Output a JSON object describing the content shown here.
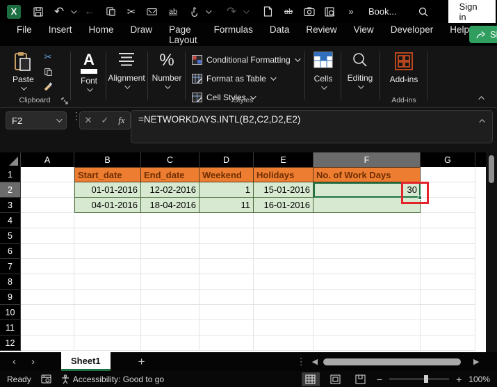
{
  "titlebar": {
    "document_title": "Book...",
    "signin_label": "Sign in",
    "glyphs": {
      "excel": "X",
      "undo": "↶",
      "redo": "↷",
      "back": "←",
      "cut": "✂",
      "replace": "ab",
      "strikethrough": "ab",
      "more": "»",
      "dots": "⋮",
      "minimize": "—",
      "maximize": "□",
      "close": "✕"
    }
  },
  "menubar": {
    "items": [
      "File",
      "Insert",
      "Home",
      "Draw",
      "Page Layout",
      "Formulas",
      "Data",
      "Review",
      "View",
      "Developer",
      "Help"
    ],
    "active_item": "Home",
    "share_label": "Share"
  },
  "ribbon": {
    "paste_label": "Paste",
    "clipboard_group_label": "Clipboard",
    "font_label": "Font",
    "font_glyph": "A",
    "alignment_label": "Alignment",
    "number_label": "Number",
    "number_glyph": "%",
    "styles_items": [
      "Conditional Formatting",
      "Format as Table",
      "Cell Styles"
    ],
    "styles_group_label": "Styles",
    "cells_label": "Cells",
    "editing_label": "Editing",
    "addins_label": "Add-ins",
    "addins_group_label": "Add-ins"
  },
  "formula_bar": {
    "name_box_value": "F2",
    "cancel_glyph": "✕",
    "enter_glyph": "✓",
    "fx_label": "fx",
    "formula": "=NETWORKDAYS.INTL(B2,C2,D2,E2)"
  },
  "sheet": {
    "columns": [
      "A",
      "B",
      "C",
      "D",
      "E",
      "F",
      "G"
    ],
    "rows": [
      "1",
      "2",
      "3",
      "4",
      "5",
      "6",
      "7",
      "8",
      "9",
      "10",
      "11",
      "12"
    ],
    "selected_column": "F",
    "selected_row": "2",
    "active_cell": "F2",
    "cells": {
      "B1": "Start_date",
      "C1": "End_date",
      "D1": "Weekend",
      "E1": "Holidays",
      "F1": "No. of Work Days",
      "B2": "01-01-2016",
      "C2": "12-02-2016",
      "D2": "1",
      "E2": "15-01-2016",
      "F2": "30",
      "B3": "04-01-2016",
      "C3": "18-04-2016",
      "D3": "11",
      "E3": "16-01-2016",
      "F3": ""
    }
  },
  "sheet_tabs": {
    "active_tab": "Sheet1",
    "add_sheet_glyph": "+",
    "prev_glyph": "‹",
    "next_glyph": "›"
  },
  "status_bar": {
    "ready_label": "Ready",
    "accessibility_label": "Accessibility: Good to go",
    "zoom_level": "100%",
    "zoom_minus": "−",
    "zoom_plus": "+"
  },
  "colors": {
    "titlebar_bg": "#000000",
    "excel_green": "#1d6f42",
    "share_green": "#2f9e5f",
    "home_underline": "#4fa36f",
    "table_header_fill": "#ED7D31",
    "table_header_text": "#6e2e00",
    "table_data_fill": "#D7E9D0",
    "annotation_red": "#e3242b",
    "selection_green": "#1e7145",
    "addins_orange": "#b5461e"
  }
}
